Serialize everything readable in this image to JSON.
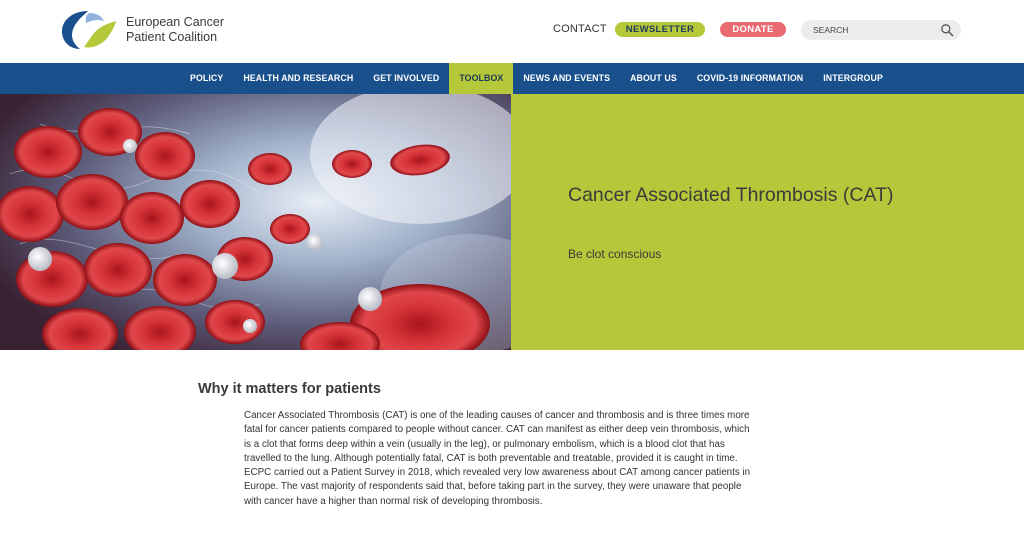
{
  "header": {
    "org_line1": "European Cancer",
    "org_line2": "Patient Coalition",
    "contact_label": "CONTACT",
    "newsletter_label": "NEWSLETTER",
    "donate_label": "DONATE",
    "search_placeholder": "SEARCH",
    "colors": {
      "green": "#b5c83a",
      "blue": "#19508c",
      "pink": "#e86b72"
    }
  },
  "nav": {
    "items": [
      {
        "label": "POLICY"
      },
      {
        "label": "HEALTH AND RESEARCH"
      },
      {
        "label": "GET INVOLVED"
      },
      {
        "label": "TOOLBOX",
        "active": true
      },
      {
        "label": "NEWS AND EVENTS"
      },
      {
        "label": "ABOUT US"
      },
      {
        "label": "COVID-19 INFORMATION"
      },
      {
        "label": "INTERGROUP"
      }
    ]
  },
  "hero": {
    "title": "Cancer Associated Thrombosis (CAT)",
    "subtitle": "Be clot conscious"
  },
  "content": {
    "heading": "Why it matters for patients",
    "body_lines": [
      "Cancer Associated Thrombosis (CAT) is one of the leading causes of cancer and thrombosis and is three times more",
      "fatal for cancer patients compared to people without cancer. CAT can manifest as either deep vein thrombosis, which",
      "is a clot that forms deep within a vein (usually in the leg), or pulmonary embolism, which is a blood clot that has",
      "travelled to the lung. Although potentially fatal, CAT is both preventable and treatable, provided it is caught in time.",
      "ECPC carried out a Patient Survey in 2018, which revealed very low awareness about CAT among cancer patients in",
      "Europe. The vast majority of respondents said that, before taking part in the survey, they were unaware that people",
      "with cancer have a higher than normal risk of developing thrombosis."
    ]
  }
}
